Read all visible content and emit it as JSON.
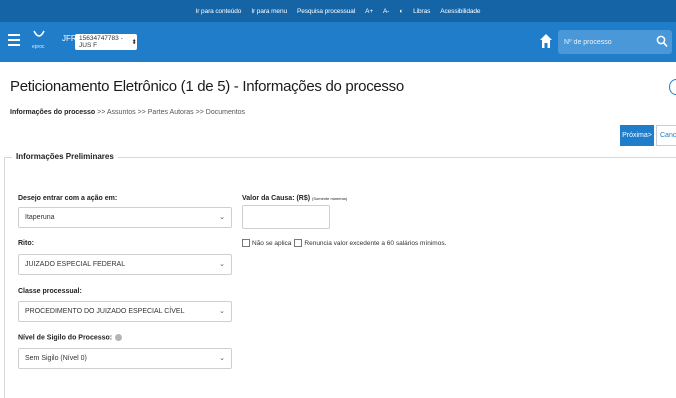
{
  "access_bar": {
    "items": [
      "Ir para conteúdo",
      "Ir para menu",
      "Pesquisa processual",
      "A+",
      "A-",
      "◐",
      "Libras",
      "Acessibilidade"
    ]
  },
  "header": {
    "brand": "eproc",
    "org": "JFRJ",
    "profile": "15634747783 - JUS F",
    "search_placeholder": "Nº de processo"
  },
  "page": {
    "title": "Peticionamento Eletrônico (1 de 5) - Informações do processo"
  },
  "breadcrumb": {
    "current": "Informações do processo",
    "separator1": " >> ",
    "step2": "Assuntos",
    "separator2": " >> ",
    "step3": "Partes Autoras",
    "separator3": " >> ",
    "step4": "Documentos"
  },
  "actions": {
    "next": "Próxima>",
    "cancel": "Cancelar"
  },
  "form": {
    "legend": "Informações Preliminares",
    "acao_label": "Desejo entrar com a ação em:",
    "acao_value": "Itaperuna",
    "rito_label": "Rito:",
    "rito_value": "JUIZADO ESPECIAL FEDERAL",
    "classe_label": "Classe processual:",
    "classe_value": "PROCEDIMENTO DO JUIZADO ESPECIAL CÍVEL",
    "sigilo_label": "Nível de Sigilo do Processo:",
    "sigilo_value": "Sem Sigilo (Nível 0)",
    "valor_label": "Valor da Causa: (R$)",
    "valor_hint": "(Somente números)",
    "valor_value": "",
    "nao_se_aplica": "Não se aplica",
    "renuncia": "Renuncia valor excedente a 60 salários mínimos."
  }
}
